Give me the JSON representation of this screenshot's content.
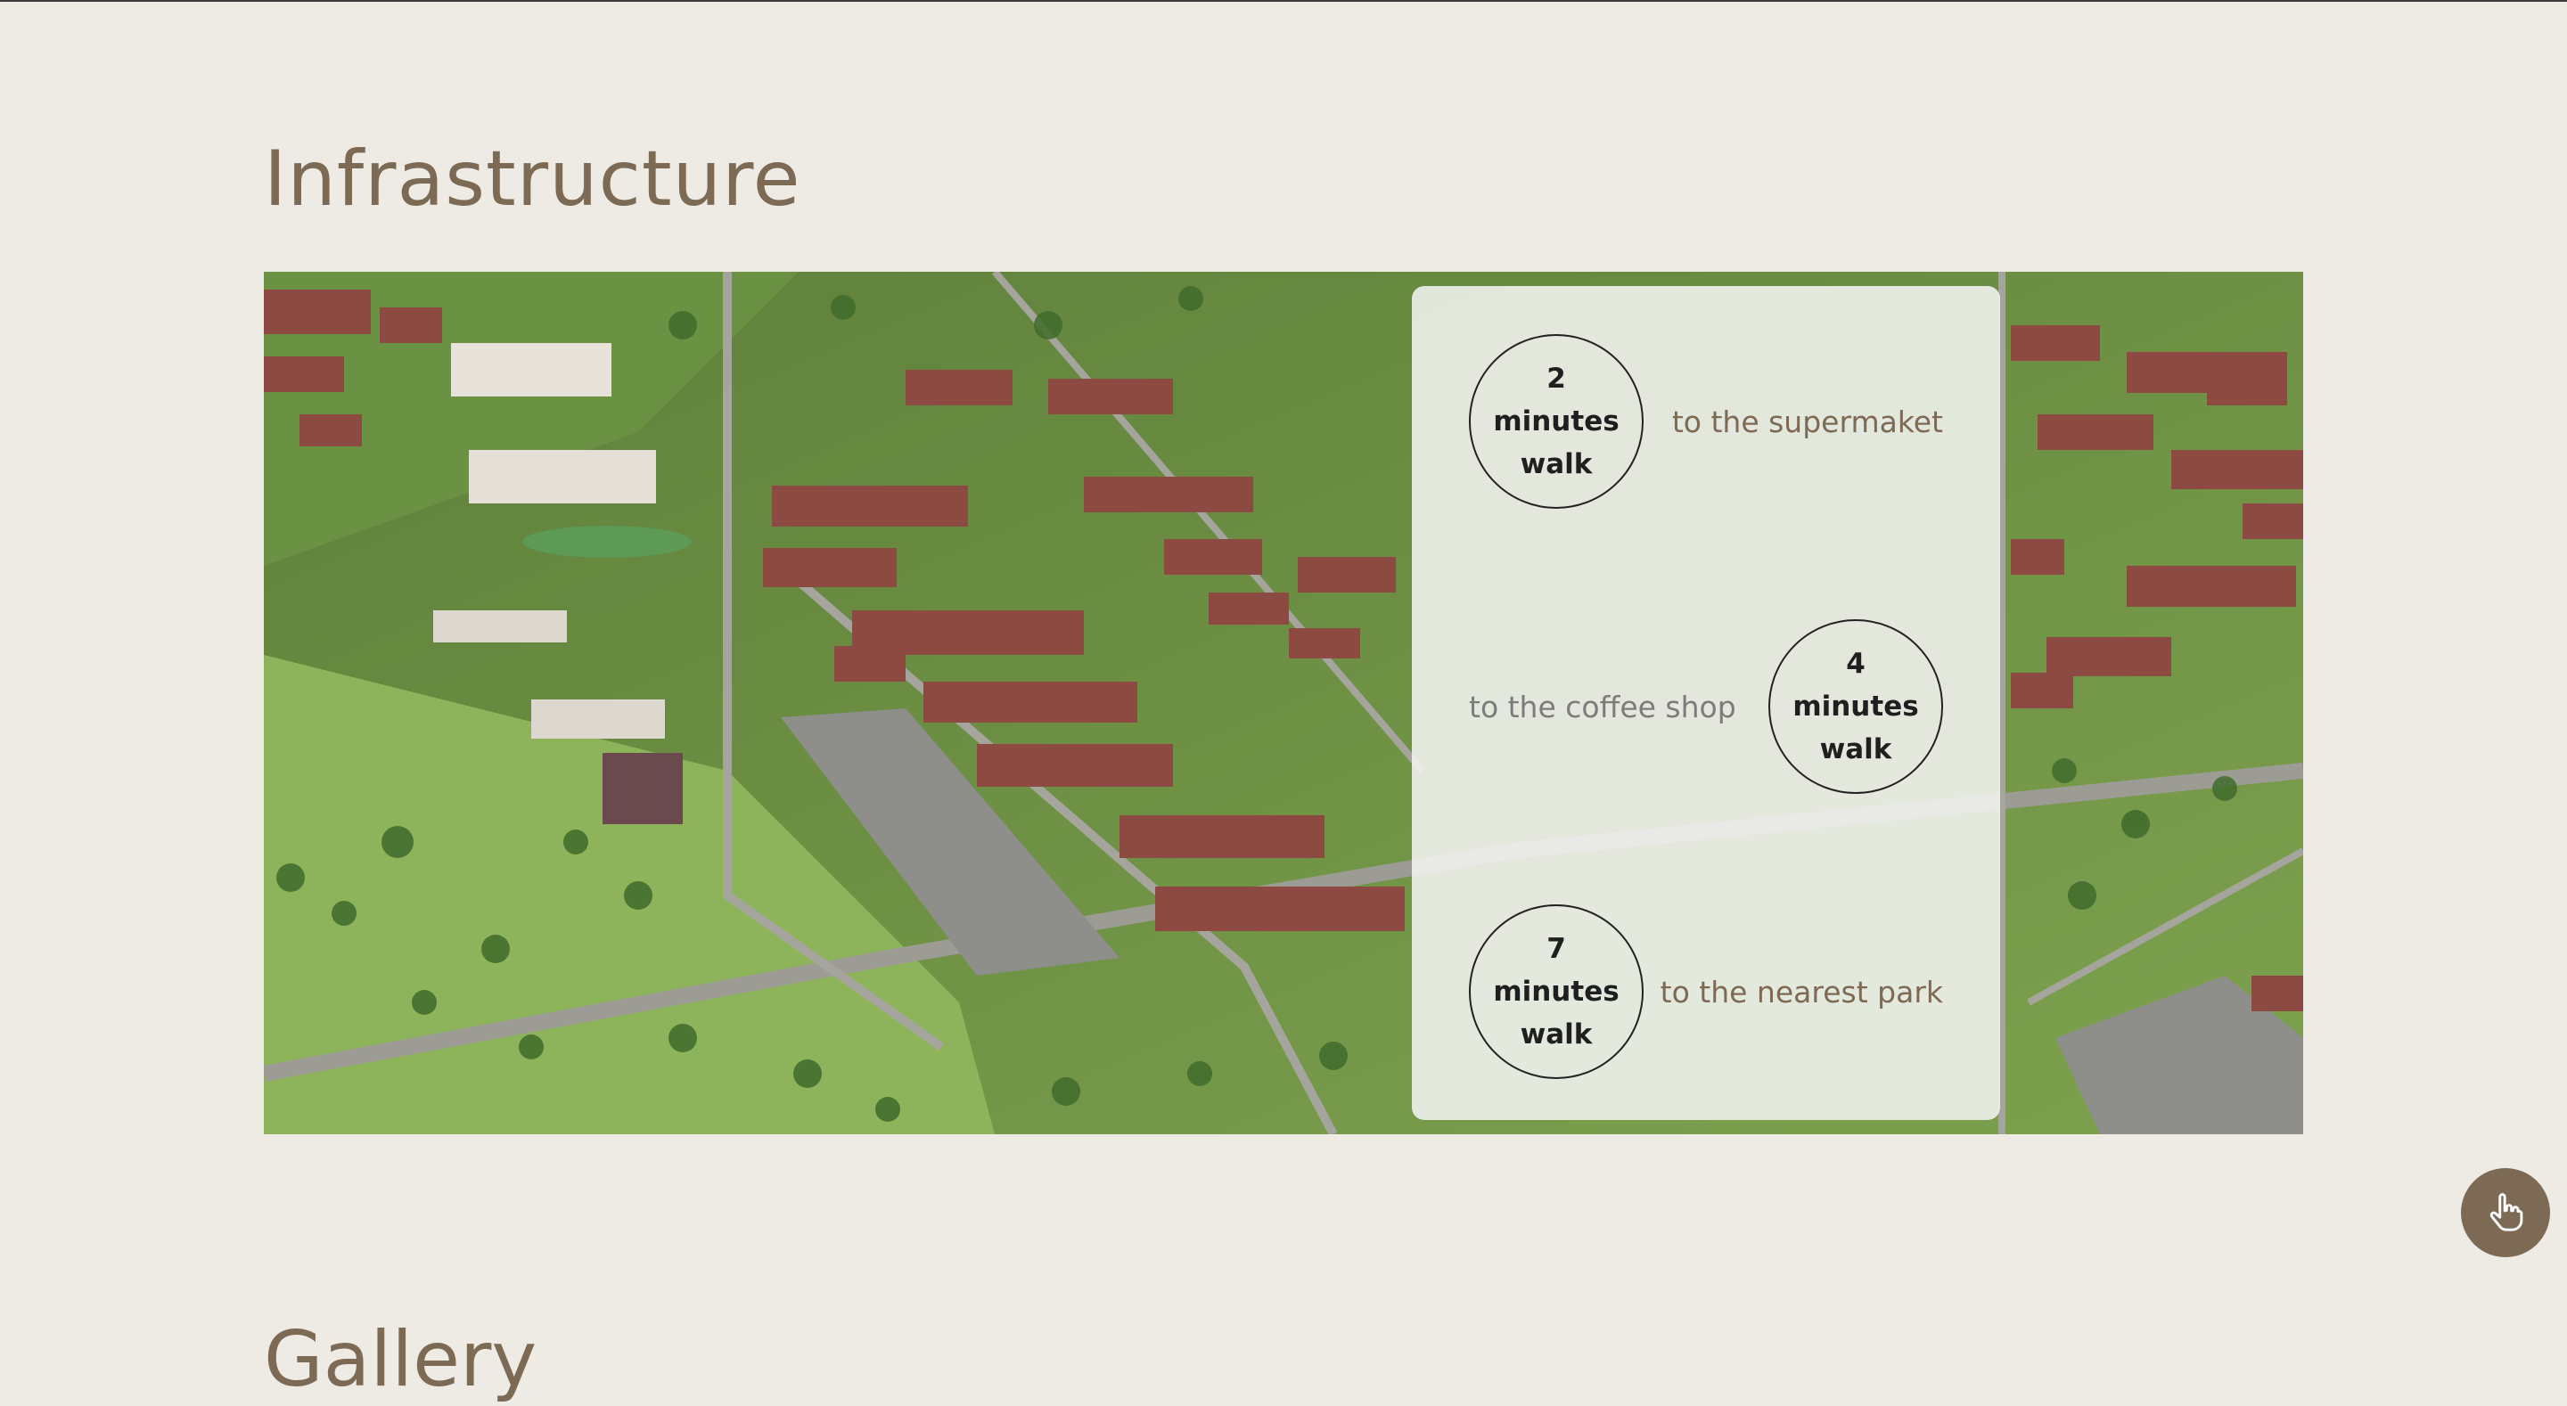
{
  "section": {
    "title": "Infrastructure"
  },
  "next_section": {
    "title": "Gallery"
  },
  "infrastructure": {
    "items": [
      {
        "time": "2 minutes walk",
        "destination": "to the supermaket"
      },
      {
        "time": "4 minutes walk",
        "destination": "to the coffee shop"
      },
      {
        "time": "7 minutes walk",
        "destination": "to the nearest park"
      }
    ]
  },
  "fab": {
    "icon": "hand-pointer-icon"
  },
  "colors": {
    "background": "#EEEBE5",
    "accent": "#7D6A55",
    "card": "#F4F4F1",
    "text_dark": "#1F1F1F"
  }
}
